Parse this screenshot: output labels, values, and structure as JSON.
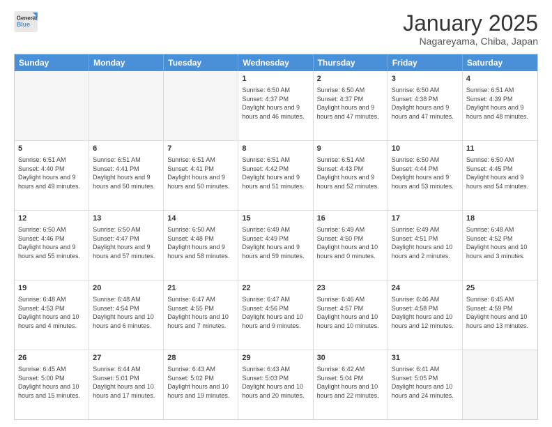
{
  "header": {
    "logo_line1": "General",
    "logo_line2": "Blue",
    "month_title": "January 2025",
    "location": "Nagareyama, Chiba, Japan"
  },
  "days_of_week": [
    "Sunday",
    "Monday",
    "Tuesday",
    "Wednesday",
    "Thursday",
    "Friday",
    "Saturday"
  ],
  "weeks": [
    [
      {
        "day": "",
        "empty": true
      },
      {
        "day": "",
        "empty": true
      },
      {
        "day": "",
        "empty": true
      },
      {
        "day": "1",
        "sunrise": "6:50 AM",
        "sunset": "4:37 PM",
        "daylight": "9 hours and 46 minutes."
      },
      {
        "day": "2",
        "sunrise": "6:50 AM",
        "sunset": "4:37 PM",
        "daylight": "9 hours and 47 minutes."
      },
      {
        "day": "3",
        "sunrise": "6:50 AM",
        "sunset": "4:38 PM",
        "daylight": "9 hours and 47 minutes."
      },
      {
        "day": "4",
        "sunrise": "6:51 AM",
        "sunset": "4:39 PM",
        "daylight": "9 hours and 48 minutes."
      }
    ],
    [
      {
        "day": "5",
        "sunrise": "6:51 AM",
        "sunset": "4:40 PM",
        "daylight": "9 hours and 49 minutes."
      },
      {
        "day": "6",
        "sunrise": "6:51 AM",
        "sunset": "4:41 PM",
        "daylight": "9 hours and 50 minutes."
      },
      {
        "day": "7",
        "sunrise": "6:51 AM",
        "sunset": "4:41 PM",
        "daylight": "9 hours and 50 minutes."
      },
      {
        "day": "8",
        "sunrise": "6:51 AM",
        "sunset": "4:42 PM",
        "daylight": "9 hours and 51 minutes."
      },
      {
        "day": "9",
        "sunrise": "6:51 AM",
        "sunset": "4:43 PM",
        "daylight": "9 hours and 52 minutes."
      },
      {
        "day": "10",
        "sunrise": "6:50 AM",
        "sunset": "4:44 PM",
        "daylight": "9 hours and 53 minutes."
      },
      {
        "day": "11",
        "sunrise": "6:50 AM",
        "sunset": "4:45 PM",
        "daylight": "9 hours and 54 minutes."
      }
    ],
    [
      {
        "day": "12",
        "sunrise": "6:50 AM",
        "sunset": "4:46 PM",
        "daylight": "9 hours and 55 minutes."
      },
      {
        "day": "13",
        "sunrise": "6:50 AM",
        "sunset": "4:47 PM",
        "daylight": "9 hours and 57 minutes."
      },
      {
        "day": "14",
        "sunrise": "6:50 AM",
        "sunset": "4:48 PM",
        "daylight": "9 hours and 58 minutes."
      },
      {
        "day": "15",
        "sunrise": "6:49 AM",
        "sunset": "4:49 PM",
        "daylight": "9 hours and 59 minutes."
      },
      {
        "day": "16",
        "sunrise": "6:49 AM",
        "sunset": "4:50 PM",
        "daylight": "10 hours and 0 minutes."
      },
      {
        "day": "17",
        "sunrise": "6:49 AM",
        "sunset": "4:51 PM",
        "daylight": "10 hours and 2 minutes."
      },
      {
        "day": "18",
        "sunrise": "6:48 AM",
        "sunset": "4:52 PM",
        "daylight": "10 hours and 3 minutes."
      }
    ],
    [
      {
        "day": "19",
        "sunrise": "6:48 AM",
        "sunset": "4:53 PM",
        "daylight": "10 hours and 4 minutes."
      },
      {
        "day": "20",
        "sunrise": "6:48 AM",
        "sunset": "4:54 PM",
        "daylight": "10 hours and 6 minutes."
      },
      {
        "day": "21",
        "sunrise": "6:47 AM",
        "sunset": "4:55 PM",
        "daylight": "10 hours and 7 minutes."
      },
      {
        "day": "22",
        "sunrise": "6:47 AM",
        "sunset": "4:56 PM",
        "daylight": "10 hours and 9 minutes."
      },
      {
        "day": "23",
        "sunrise": "6:46 AM",
        "sunset": "4:57 PM",
        "daylight": "10 hours and 10 minutes."
      },
      {
        "day": "24",
        "sunrise": "6:46 AM",
        "sunset": "4:58 PM",
        "daylight": "10 hours and 12 minutes."
      },
      {
        "day": "25",
        "sunrise": "6:45 AM",
        "sunset": "4:59 PM",
        "daylight": "10 hours and 13 minutes."
      }
    ],
    [
      {
        "day": "26",
        "sunrise": "6:45 AM",
        "sunset": "5:00 PM",
        "daylight": "10 hours and 15 minutes."
      },
      {
        "day": "27",
        "sunrise": "6:44 AM",
        "sunset": "5:01 PM",
        "daylight": "10 hours and 17 minutes."
      },
      {
        "day": "28",
        "sunrise": "6:43 AM",
        "sunset": "5:02 PM",
        "daylight": "10 hours and 19 minutes."
      },
      {
        "day": "29",
        "sunrise": "6:43 AM",
        "sunset": "5:03 PM",
        "daylight": "10 hours and 20 minutes."
      },
      {
        "day": "30",
        "sunrise": "6:42 AM",
        "sunset": "5:04 PM",
        "daylight": "10 hours and 22 minutes."
      },
      {
        "day": "31",
        "sunrise": "6:41 AM",
        "sunset": "5:05 PM",
        "daylight": "10 hours and 24 minutes."
      },
      {
        "day": "",
        "empty": true
      }
    ]
  ]
}
